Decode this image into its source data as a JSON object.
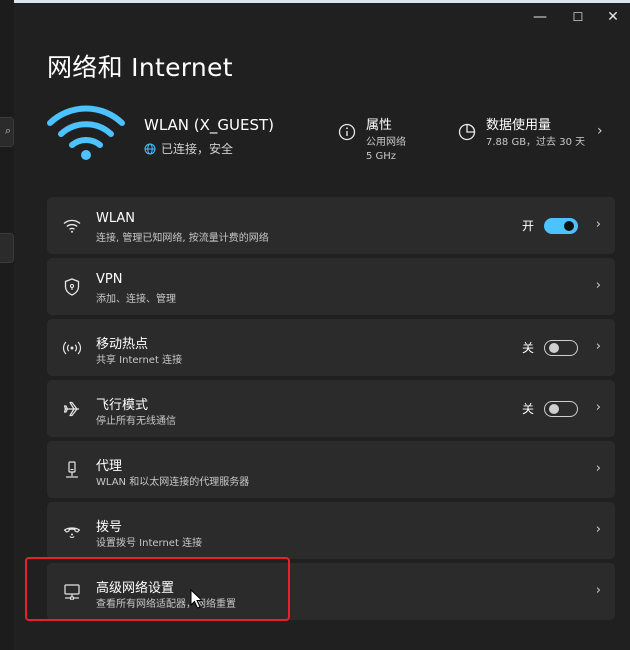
{
  "window": {
    "minimize_glyph": "—",
    "maximize_glyph": "☐",
    "close_glyph": "✕"
  },
  "page": {
    "title": "网络和 Internet"
  },
  "hero": {
    "network_name": "WLAN (X_GUEST)",
    "status": "已连接，安全",
    "properties": {
      "title": "属性",
      "line1": "公用网络",
      "line2": "5 GHz"
    },
    "data_usage": {
      "title": "数据使用量",
      "detail": "7.88 GB，过去 30 天"
    }
  },
  "rows": [
    {
      "icon": "wifi-icon",
      "title": "WLAN",
      "subtitle": "连接, 管理已知网络, 按流量计费的网络",
      "toggle_label": "开",
      "toggle_state": "on"
    },
    {
      "icon": "shield-icon",
      "title": "VPN",
      "subtitle": "添加、连接、管理"
    },
    {
      "icon": "hotspot-icon",
      "title": "移动热点",
      "subtitle": "共享 Internet 连接",
      "toggle_label": "关",
      "toggle_state": "off"
    },
    {
      "icon": "airplane-icon",
      "title": "飞行模式",
      "subtitle": "停止所有无线通信",
      "toggle_label": "关",
      "toggle_state": "off"
    },
    {
      "icon": "proxy-icon",
      "title": "代理",
      "subtitle": "WLAN 和以太网连接的代理服务器"
    },
    {
      "icon": "dialup-icon",
      "title": "拨号",
      "subtitle": "设置拨号 Internet 连接"
    },
    {
      "icon": "network-computer-icon",
      "title": "高级网络设置",
      "subtitle": "查看所有网络适配器，网络重置"
    }
  ],
  "colors": {
    "accent": "#4cc2ff",
    "highlight": "#e8202a",
    "background": "#202020",
    "card": "#2b2b2b"
  },
  "chevron": "›"
}
